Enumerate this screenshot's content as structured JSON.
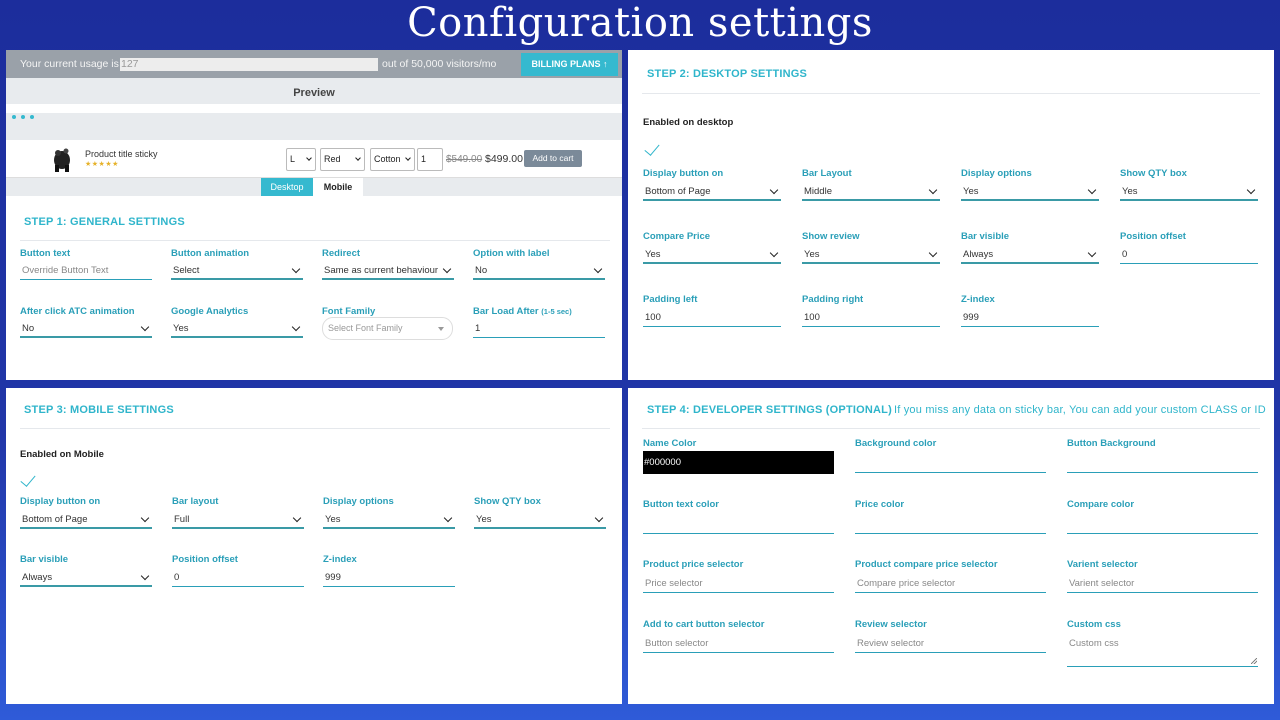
{
  "banner": {
    "title": "Configuration settings"
  },
  "usage": {
    "prefix": "Your current usage is",
    "value": "127",
    "suffix": "out of 50,000 visitors/mo",
    "billing_label": "BILLING PLANS ↑"
  },
  "preview": {
    "label": "Preview",
    "product_title": "Product title sticky",
    "stars": "★★★★★",
    "size": "L",
    "color": "Red",
    "material": "Cotton",
    "qty": "1",
    "price_old": "$549.00",
    "price_new": "$499.00",
    "atc_label": "Add to cart",
    "tab_desktop": "Desktop",
    "tab_mobile": "Mobile"
  },
  "step1": {
    "title": "STEP 1: GENERAL SETTINGS",
    "fields": [
      {
        "label": "Button text",
        "value": "Override Button Text"
      },
      {
        "label": "Button animation",
        "value": "Select"
      },
      {
        "label": "Redirect",
        "value": "Same as current behaviour"
      },
      {
        "label": "Option with label",
        "value": "No"
      },
      {
        "label": "After click ATC animation",
        "value": "No"
      },
      {
        "label": "Google Analytics",
        "value": "Yes"
      },
      {
        "label": "Font Family",
        "value": "Select Font Family"
      },
      {
        "label": "Bar Load After",
        "hint": "(1-5 sec)",
        "value": "1"
      }
    ]
  },
  "step2": {
    "title": "STEP 2: DESKTOP SETTINGS",
    "enabled_label": "Enabled on desktop",
    "fields": [
      {
        "label": "Display button on",
        "value": "Bottom of Page"
      },
      {
        "label": "Bar Layout",
        "value": "Middle"
      },
      {
        "label": "Display options",
        "value": "Yes"
      },
      {
        "label": "Show QTY box",
        "value": "Yes"
      },
      {
        "label": "Compare Price",
        "value": "Yes"
      },
      {
        "label": "Show review",
        "value": "Yes"
      },
      {
        "label": "Bar visible",
        "value": "Always"
      },
      {
        "label": "Position offset",
        "value": "0"
      },
      {
        "label": "Padding left",
        "value": "100"
      },
      {
        "label": "Padding right",
        "value": "100"
      },
      {
        "label": "Z-index",
        "value": "999"
      }
    ]
  },
  "step3": {
    "title": "STEP 3: MOBILE SETTINGS",
    "enabled_label": "Enabled on Mobile",
    "fields": [
      {
        "label": "Display button on",
        "value": "Bottom of Page"
      },
      {
        "label": "Bar layout",
        "value": "Full"
      },
      {
        "label": "Display options",
        "value": "Yes"
      },
      {
        "label": "Show QTY box",
        "value": "Yes"
      },
      {
        "label": "Bar visible",
        "value": "Always"
      },
      {
        "label": "Position offset",
        "value": "0"
      },
      {
        "label": "Z-index",
        "value": "999"
      }
    ]
  },
  "step4": {
    "title": "STEP 4: DEVELOPER SETTINGS (OPTIONAL)",
    "note": "If you miss any data on sticky bar, You can add your custom CLASS or ID",
    "fields": [
      {
        "label": "Name Color",
        "value": "#000000"
      },
      {
        "label": "Background color",
        "value": ""
      },
      {
        "label": "Button Background",
        "value": ""
      },
      {
        "label": "Button text color",
        "value": ""
      },
      {
        "label": "Price color",
        "value": ""
      },
      {
        "label": "Compare color",
        "value": ""
      },
      {
        "label": "Product price selector",
        "value": "Price selector"
      },
      {
        "label": "Product compare price selector",
        "value": "Compare price selector"
      },
      {
        "label": "Varient selector",
        "value": "Varient selector"
      },
      {
        "label": "Add to cart button selector",
        "value": "Button selector"
      },
      {
        "label": "Review selector",
        "value": "Review selector"
      },
      {
        "label": "Custom css",
        "value": "Custom css"
      }
    ]
  },
  "colors": {
    "accent": "#2fb5cb",
    "label": "#2a9fb8",
    "background": "#2136a8"
  }
}
